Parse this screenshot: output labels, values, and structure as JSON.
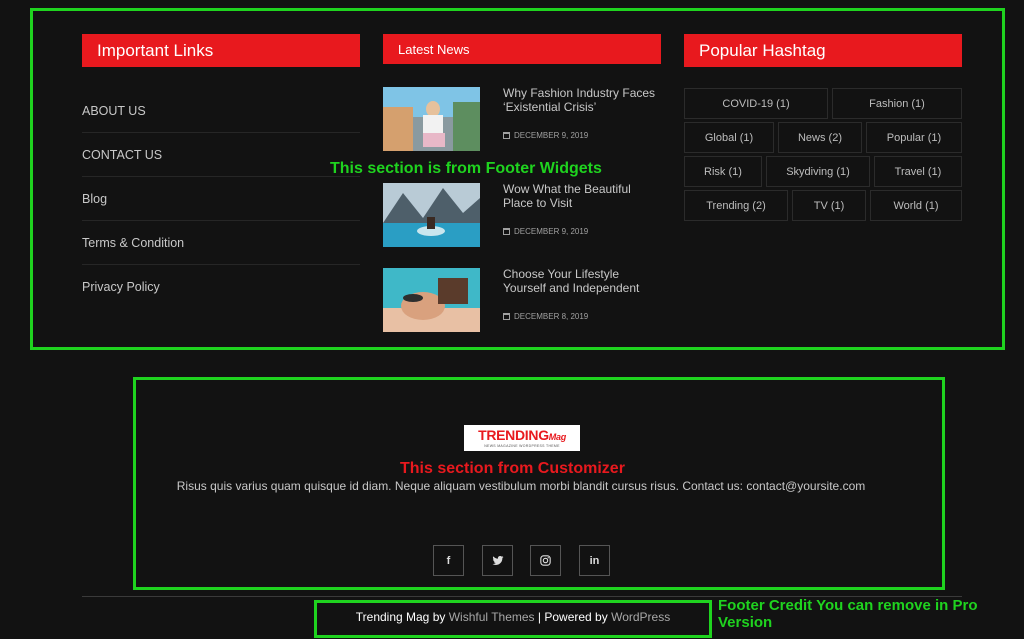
{
  "annotations": {
    "widgets": "This section is from Footer Widgets",
    "customizer": "This section from Customizer",
    "credit": "Footer Credit You can remove in Pro Version"
  },
  "important_links": {
    "title": "Important Links",
    "items": [
      "ABOUT US",
      "CONTACT US",
      "Blog",
      "Terms & Condition",
      "Privacy Policy"
    ]
  },
  "latest_news": {
    "title": "Latest News",
    "items": [
      {
        "title": "Why Fashion Industry Faces ‘Existential Crisis’",
        "date": "DECEMBER 9, 2019"
      },
      {
        "title": "Wow What the Beautiful Place to Visit",
        "date": "DECEMBER 9, 2019"
      },
      {
        "title": "Choose Your Lifestyle Yourself and Independent",
        "date": "DECEMBER 8, 2019"
      }
    ]
  },
  "popular_hashtag": {
    "title": "Popular Hashtag",
    "tags": [
      "COVID-19 (1)",
      "Fashion (1)",
      "Global (1)",
      "News (2)",
      "Popular (1)",
      "Risk (1)",
      "Skydiving (1)",
      "Travel (1)",
      "Trending (2)",
      "TV (1)",
      "World (1)"
    ]
  },
  "logo": {
    "main": "TRENDING",
    "accent": "Mag",
    "tagline": "NEWS MAGAZINE WORDPRESS THEME"
  },
  "description": "Risus quis varius quam quisque id diam. Neque aliquam vestibulum morbi blandit cursus risus. Contact us: contact@yoursite.com",
  "social": [
    {
      "icon": "facebook-icon",
      "glyph": "f"
    },
    {
      "icon": "twitter-icon",
      "glyph": "🐦"
    },
    {
      "icon": "instagram-icon",
      "glyph": "◎"
    },
    {
      "icon": "linkedin-icon",
      "glyph": "in"
    }
  ],
  "credit": {
    "theme": "Trending Mag",
    "by": "by",
    "author": "Wishful Themes",
    "separator": "|",
    "powered": "Powered by",
    "platform": "WordPress"
  },
  "colors": {
    "accent": "#e8191e",
    "annotation_green": "#1fd31f",
    "background": "#121212"
  }
}
